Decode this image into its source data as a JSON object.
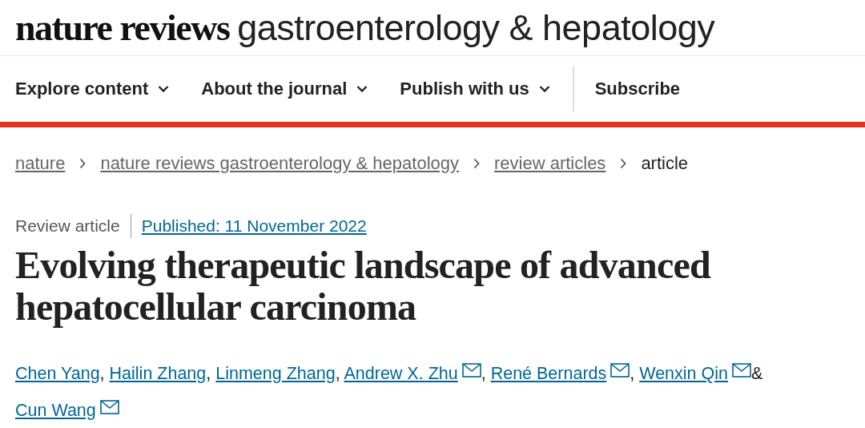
{
  "logo": {
    "brand": "nature reviews",
    "journal": "gastroenterology & hepatology"
  },
  "nav": [
    {
      "label": "Explore content",
      "dropdown": true
    },
    {
      "label": "About the journal",
      "dropdown": true
    },
    {
      "label": "Publish with us",
      "dropdown": true
    },
    {
      "label": "Subscribe",
      "dropdown": false
    }
  ],
  "breadcrumb": [
    {
      "label": "nature",
      "link": true
    },
    {
      "label": "nature reviews gastroenterology & hepatology",
      "link": true
    },
    {
      "label": "review articles",
      "link": true
    },
    {
      "label": "article",
      "link": false
    }
  ],
  "article_type": "Review article",
  "published": "Published: 11 November 2022",
  "title": "Evolving therapeutic landscape of advanced hepatocellular carcinoma",
  "authors": [
    {
      "name": "Chen Yang",
      "email": false,
      "separator": ","
    },
    {
      "name": "Hailin Zhang",
      "email": false,
      "separator": ","
    },
    {
      "name": "Linmeng Zhang",
      "email": false,
      "separator": ","
    },
    {
      "name": "Andrew X. Zhu",
      "email": true,
      "separator": ","
    },
    {
      "name": "René Bernards",
      "email": true,
      "separator": ","
    },
    {
      "name": "Wenxin Qin",
      "email": true,
      "separator": "&"
    },
    {
      "name": "Cun Wang",
      "email": true
    }
  ]
}
